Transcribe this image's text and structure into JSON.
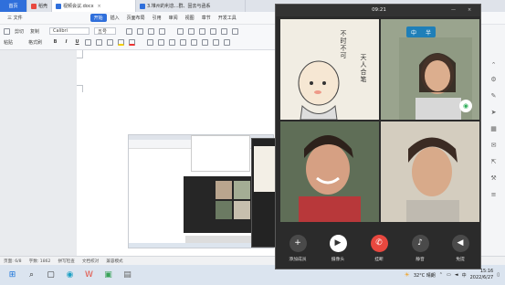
{
  "tabs": {
    "home": "首页",
    "items": [
      {
        "label": "稻壳",
        "color": "#e8483f"
      },
      {
        "label": "视频会议.docx",
        "color": "#2f6fdb"
      },
      {
        "label": "3.堆州的利息...群、固去与函系",
        "color": "#2f6fdb"
      }
    ]
  },
  "menu": {
    "file": "三 文件",
    "items": [
      "开始",
      "插入",
      "页面布局",
      "引用",
      "审阅",
      "视图",
      "章节",
      "开发工具"
    ]
  },
  "toolbar": {
    "paste": "粘贴",
    "cut": "剪切",
    "copy": "复制",
    "format_painter": "格式刷",
    "font": "Calibri",
    "size": "五号",
    "bold": "B",
    "italic": "I",
    "underline": "U"
  },
  "statusbar": {
    "page": "页面: 6/8",
    "words": "字数: 1862",
    "spell": "拼写检查",
    "doc_check": "文档校对",
    "compat": "兼容模式"
  },
  "phone": {
    "time": "09:21",
    "calligraphy_right": "不时不可",
    "calligraphy_left": "天人合笔",
    "chip_left": "中",
    "chip_right": "半",
    "controls": [
      {
        "label": "添加成员",
        "icon": "+"
      },
      {
        "label": "摄像头",
        "icon": "▶"
      },
      {
        "label": "挂断",
        "icon": "✆"
      },
      {
        "label": "静音",
        "icon": "♪"
      },
      {
        "label": "免提",
        "icon": "◀"
      }
    ]
  },
  "taskbar": {
    "weather": "32°C 晴朗",
    "lang": "中",
    "time": "15:16",
    "date": "2022/6/27"
  }
}
